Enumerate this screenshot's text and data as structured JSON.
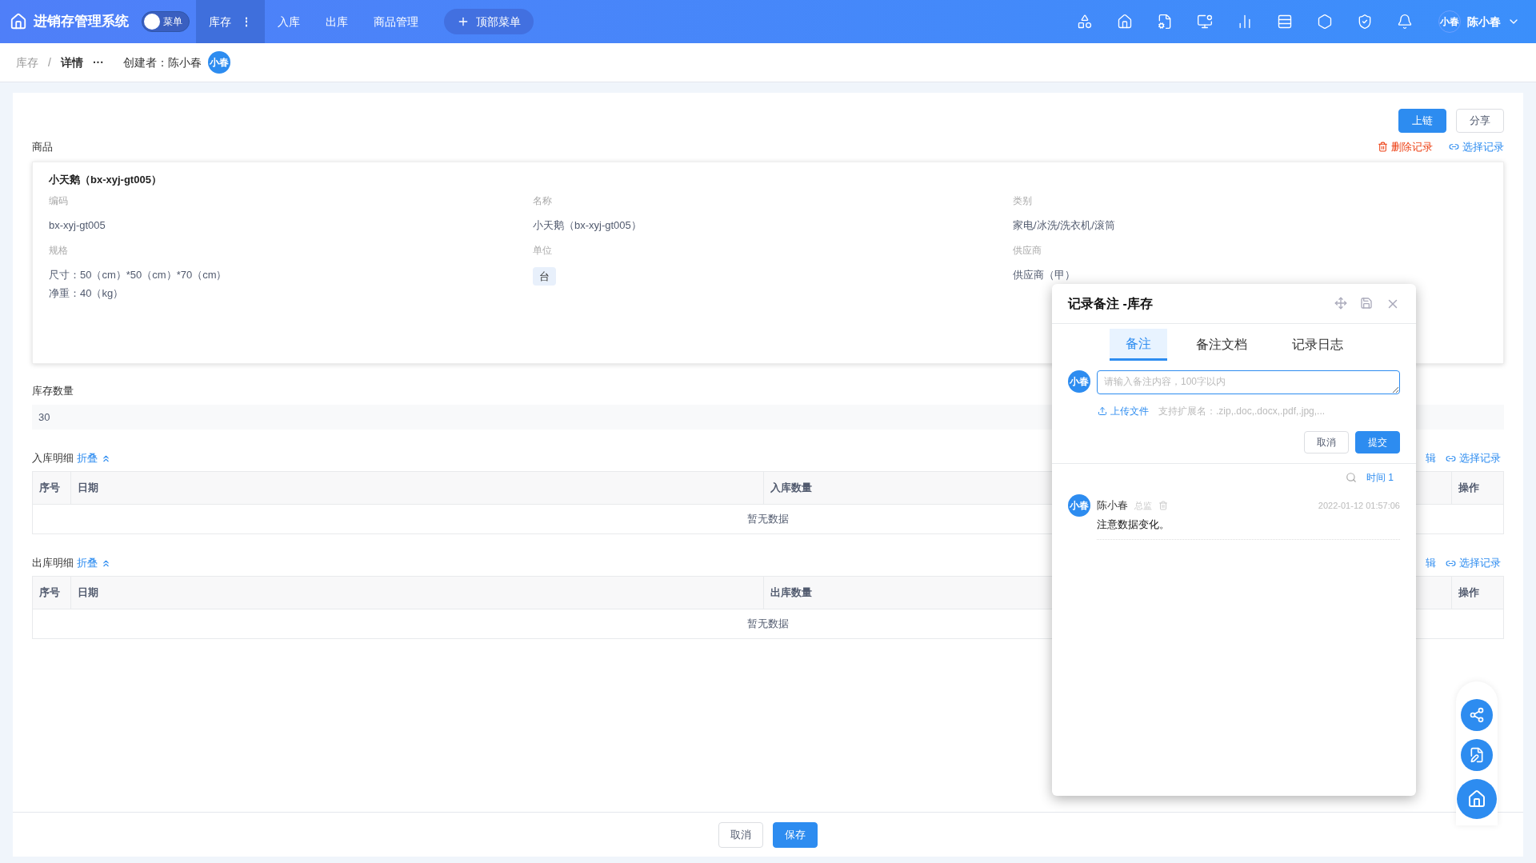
{
  "header": {
    "app_title": "进销存管理系统",
    "menu_toggle": {
      "label": "菜单",
      "on": false
    },
    "nav": [
      {
        "label": "库存",
        "selected": true,
        "more": "⋮"
      },
      {
        "label": "入库",
        "selected": false
      },
      {
        "label": "出库",
        "selected": false
      },
      {
        "label": "商品管理",
        "selected": false
      }
    ],
    "top_menu_button": "顶部菜单",
    "user": {
      "avatar": "小春",
      "name": "陈小春"
    }
  },
  "breadcrumb": {
    "items": [
      "库存",
      "详情"
    ],
    "separator": "/",
    "more": "···",
    "creator_label": "创建者：陈小春",
    "creator_avatar": "小春"
  },
  "toolbar": {
    "buttons": [
      {
        "label": "上链",
        "kind": "primary"
      },
      {
        "label": "分享",
        "kind": "default"
      }
    ]
  },
  "product": {
    "label": "商品",
    "actions": [
      {
        "label": "删除记录",
        "kind": "danger"
      },
      {
        "label": "选择记录",
        "kind": "link"
      }
    ],
    "title": "小天鹅（bx-xyj-gt005）",
    "fields": [
      {
        "label": "编码",
        "value": "bx-xyj-gt005",
        "kind": "text"
      },
      {
        "label": "名称",
        "value": "小天鹅（bx-xyj-gt005）",
        "kind": "text"
      },
      {
        "label": "类别",
        "value": "家电/冰洗/洗衣机/滚筒",
        "kind": "text"
      },
      {
        "label": "规格",
        "lines": [
          "尺寸：50（cm）*50（cm）*70（cm）",
          "净重：40（kg）"
        ],
        "kind": "lines"
      },
      {
        "label": "单位",
        "value": "台",
        "kind": "tag"
      },
      {
        "label": "供应商",
        "value": "供应商（甲）",
        "kind": "text"
      }
    ]
  },
  "stock": {
    "label": "库存数量",
    "value": "30"
  },
  "tables": [
    {
      "title": "入库明细",
      "toggle": "折叠",
      "actions": [
        "辑",
        "选择记录"
      ],
      "columns": [
        "序号",
        "日期",
        "入库数量",
        "操作"
      ],
      "empty": "暂无数据"
    },
    {
      "title": "出库明细",
      "toggle": "折叠",
      "actions": [
        "辑",
        "选择记录"
      ],
      "columns": [
        "序号",
        "日期",
        "出库数量",
        "操作"
      ],
      "empty": "暂无数据"
    }
  ],
  "footer": {
    "buttons": [
      {
        "label": "取消",
        "kind": "default"
      },
      {
        "label": "保存",
        "kind": "primary"
      }
    ]
  },
  "dialog": {
    "title": "记录备注 -库存",
    "tabs": [
      {
        "label": "备注",
        "selected": true
      },
      {
        "label": "备注文档",
        "selected": false
      },
      {
        "label": "记录日志",
        "selected": false
      }
    ],
    "avatar": "小春",
    "placeholder": "请输入备注内容，100字以内",
    "upload": "上传文件",
    "upload_hint": "支持扩展名：.zip,.doc,.docx,.pdf,.jpg,...",
    "buttons": [
      {
        "label": "取消",
        "kind": "default"
      },
      {
        "label": "提交",
        "kind": "primary"
      }
    ],
    "sort": "时间 1",
    "comments": [
      {
        "avatar": "小春",
        "name": "陈小春",
        "role": "总监",
        "time": "2022-01-12 01:57:06",
        "text": "注意数据变化。"
      }
    ]
  }
}
